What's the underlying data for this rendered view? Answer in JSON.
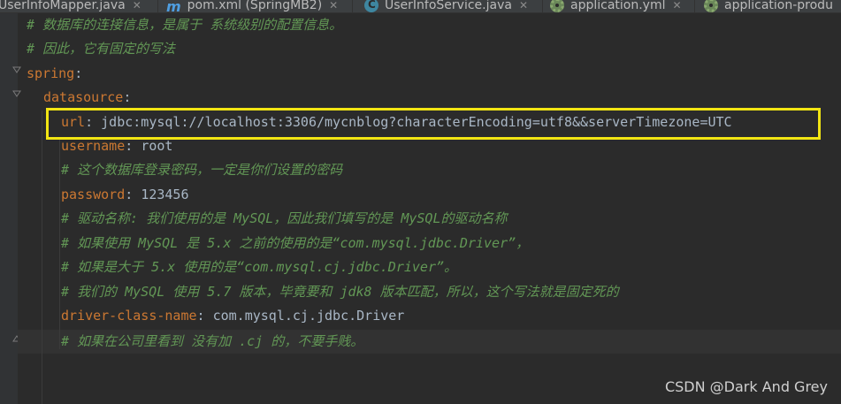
{
  "tabs": [
    {
      "label": "UserInfoMapper.java",
      "icon": "java-file-icon"
    },
    {
      "label": "pom.xml (SpringMB2)",
      "icon": "maven-icon"
    },
    {
      "label": "UserInfoService.java",
      "icon": "class-icon"
    },
    {
      "label": "application.yml",
      "icon": "spring-config-icon"
    },
    {
      "label": "application-produ",
      "icon": "spring-config-icon"
    }
  ],
  "code": {
    "l1_comment": "# 数据库的连接信息，是属于 系统级别的配置信息。",
    "l2_comment": "# 因此，它有固定的写法",
    "spring_key": "spring",
    "datasource_key": "datasource",
    "url_key": "url",
    "url_value": "jdbc:mysql://localhost:3306/mycnblog?characterEncoding=utf8&&serverTimezone=UTC",
    "username_key": "username",
    "username_value": "root",
    "l7_comment": "# 这个数据库登录密码，一定是你们设置的密码",
    "password_key": "password",
    "password_value": "123456",
    "l9_comment": "# 驱动名称: 我们使用的是 MySQL，因此我们填写的是 MySQL的驱动名称",
    "l10_comment": "# 如果使用 MySQL 是 5.x 之前的使用的是“com.mysql.jdbc.Driver”，",
    "l11_comment": "# 如果是大于 5.x 使用的是“com.mysql.cj.jdbc.Driver”。",
    "l12_comment": "# 我们的 MySQL 使用 5.7 版本，毕竟要和 jdk8 版本匹配，所以，这个写法就是固定死的",
    "driver_key": "driver-class-name",
    "driver_value": "com.mysql.cj.jdbc.Driver",
    "l14_comment": "# 如果在公司里看到 没有加 .cj 的，不要手贱。"
  },
  "watermark": "CSDN @Dark And Grey",
  "colors": {
    "background": "#2b2b2b",
    "key": "#cc7832",
    "comment": "#629755",
    "text": "#a9b7c6",
    "highlight_box": "#f2e513"
  }
}
